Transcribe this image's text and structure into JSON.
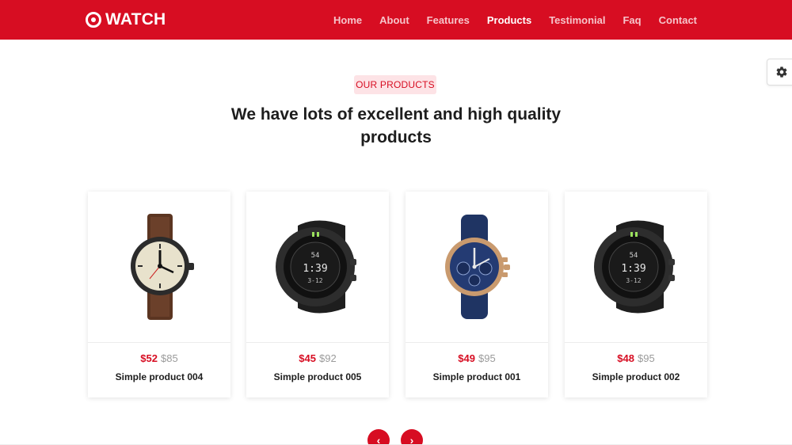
{
  "header": {
    "brand": "WATCH",
    "nav": [
      "Home",
      "About",
      "Features",
      "Products",
      "Testimonial",
      "Faq",
      "Contact"
    ],
    "active": "Products"
  },
  "section": {
    "eyebrow": "OUR PRODUCTS",
    "title_line1": "We have lots of excellent and high quality",
    "title_line2": "products"
  },
  "products": [
    {
      "name": "Simple product 004",
      "price": "$52",
      "old_price": "$85",
      "image": "field-watch-brown-strap"
    },
    {
      "name": "Simple product 005",
      "price": "$45",
      "old_price": "$92",
      "image": "digital-sport-watch-black"
    },
    {
      "name": "Simple product 001",
      "price": "$49",
      "old_price": "$95",
      "image": "chronograph-watch-blue"
    },
    {
      "name": "Simple product 002",
      "price": "$48",
      "old_price": "$95",
      "image": "digital-sport-watch-black"
    }
  ],
  "carousel": {
    "prev": "‹",
    "next": "›"
  },
  "icons": {
    "settings": "gear-icon",
    "brand": "target-icon"
  },
  "colors": {
    "brand": "#d70d22",
    "eyebrow_bg": "#fde3e6"
  }
}
